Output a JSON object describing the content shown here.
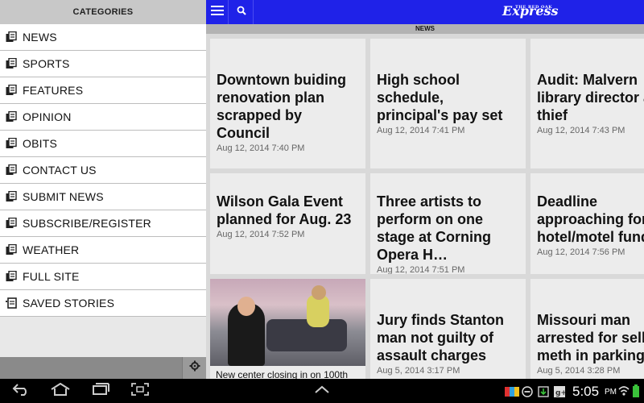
{
  "drawer": {
    "header": "CATEGORIES",
    "items": [
      {
        "label": "NEWS",
        "icon": "document-icon"
      },
      {
        "label": "SPORTS",
        "icon": "document-icon"
      },
      {
        "label": "FEATURES",
        "icon": "document-icon"
      },
      {
        "label": "OPINION",
        "icon": "document-icon"
      },
      {
        "label": "OBITS",
        "icon": "document-icon"
      },
      {
        "label": "CONTACT US",
        "icon": "document-icon"
      },
      {
        "label": "SUBMIT NEWS",
        "icon": "document-icon"
      },
      {
        "label": "SUBSCRIBE/REGISTER",
        "icon": "document-icon"
      },
      {
        "label": "WEATHER",
        "icon": "document-icon"
      },
      {
        "label": "FULL SITE",
        "icon": "document-icon"
      },
      {
        "label": "SAVED STORIES",
        "icon": "saved-document-icon"
      }
    ]
  },
  "topbar": {
    "logo_small": "THE RED OAK",
    "logo_main": "Express",
    "accent_color": "#1f22e8"
  },
  "section": {
    "title": "NEWS"
  },
  "articles": [
    {
      "title": "Downtown buiding renovation plan scrapped by Council",
      "date": "Aug 12, 2014 7:40 PM"
    },
    {
      "title": "High school schedule, principal's pay set",
      "date": "Aug 12, 2014 7:41 PM"
    },
    {
      "title": "Audit: Malvern library director a thief",
      "date": "Aug 12, 2014 7:43 PM"
    },
    {
      "title": "Wilson Gala Event planned for Aug. 23",
      "date": "Aug 12, 2014 7:52 PM"
    },
    {
      "title": "Three artists to perform on one stage at Corning Opera H…",
      "date": "Aug 12, 2014 7:51 PM"
    },
    {
      "title": "Deadline approaching for hotel/motel funds",
      "date": "Aug 12, 2014 7:56 PM"
    },
    {
      "caption": "New center closing in on 100th"
    },
    {
      "title": "Jury finds Stanton man not guilty of assault charges",
      "date": "Aug 5, 2014 3:17 PM"
    },
    {
      "title": "Missouri man arrested for selling meth in parking",
      "date": "Aug 5, 2014 3:28 PM"
    }
  ],
  "status": {
    "time": "5:05",
    "ampm": "PM"
  }
}
